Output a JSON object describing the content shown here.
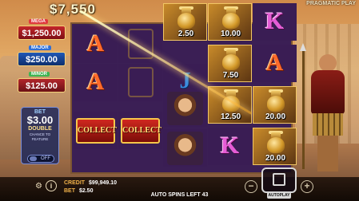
{
  "header": {
    "win_amount": "$7,550",
    "provider": "PRAGMATIC PLAY"
  },
  "jackpots": [
    {
      "name": "MEGA",
      "value": "$1,250.00"
    },
    {
      "name": "MAJOR",
      "value": "$250.00"
    },
    {
      "name": "MINOR",
      "value": "$125.00"
    }
  ],
  "bet_panel": {
    "title": "BET",
    "amount": "$3.00",
    "double_label": "DOUBLE",
    "sub_label": "CHANCE TO FEATURE",
    "toggle": "OFF"
  },
  "reels": {
    "letters": {
      "a": "A",
      "k": "K",
      "j": "J"
    },
    "collect_label": "COLLECT",
    "values": [
      "2.50",
      "10.00",
      "7.50",
      "12.50",
      "20.00",
      "20.00"
    ]
  },
  "footer": {
    "credit_label": "CREDIT",
    "credit_value": "$99,949.10",
    "bet_label": "BET",
    "bet_value": "$2.50",
    "autospins": "AUTO SPINS LEFT 43",
    "autoplay_label": "AUTOPLAY",
    "minus": "−",
    "plus": "+"
  },
  "icons": {
    "settings": "gear-icon",
    "info": "info-icon",
    "stop": "stop-icon"
  }
}
